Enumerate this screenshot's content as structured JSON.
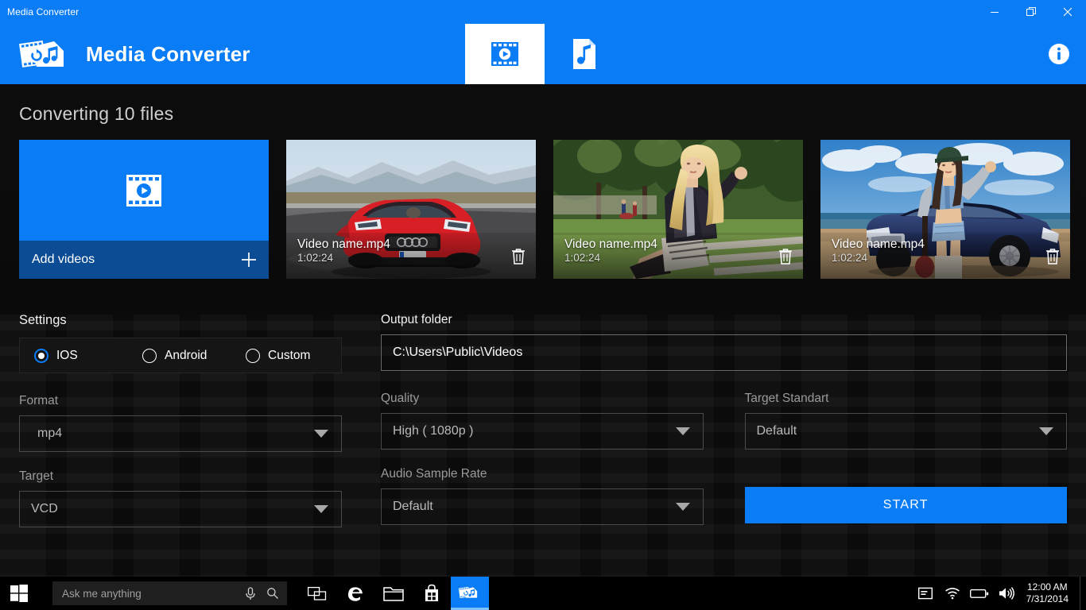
{
  "window": {
    "caption": "Media Converter",
    "minimize_label": "Minimize",
    "restore_label": "Restore",
    "close_label": "Close"
  },
  "header": {
    "brand_title": "Media Converter",
    "accent_color": "#0a7cf5",
    "tabs": [
      {
        "name": "video",
        "icon": "video-film-icon",
        "active": true
      },
      {
        "name": "audio",
        "icon": "audio-file-note-icon",
        "active": false
      }
    ],
    "info_label": "Info"
  },
  "main": {
    "page_title": "Converting 10 files",
    "add_tile": {
      "label": "Add videos",
      "icon": "video-film-play-icon",
      "plus_icon": "plus-icon"
    },
    "videos": [
      {
        "name": "Video name.mp4",
        "duration": "1:02:24",
        "delete_icon": "trash-icon",
        "thumb": "red-sports-car-on-mountain-road"
      },
      {
        "name": "Video name.mp4",
        "duration": "1:02:24",
        "delete_icon": "trash-icon",
        "thumb": "blonde-woman-on-park-bench"
      },
      {
        "name": "Video name.mp4",
        "duration": "1:02:24",
        "delete_icon": "trash-icon",
        "thumb": "woman-beside-blue-car-at-beach"
      }
    ],
    "settings": {
      "section_title": "Settings",
      "presets": [
        {
          "label": "IOS",
          "selected": true
        },
        {
          "label": "Android",
          "selected": false
        },
        {
          "label": "Custom",
          "selected": false
        }
      ],
      "format": {
        "label": "Format",
        "value": "mp4"
      },
      "target": {
        "label": "Target",
        "value": "VCD"
      }
    },
    "output": {
      "label": "Output folder",
      "value": "C:\\Users\\Public\\Videos"
    },
    "quality": {
      "label": "Quality",
      "value": "High ( 1080p )"
    },
    "audio_sample_rate": {
      "label": "Audio Sample Rate",
      "value": "Default"
    },
    "target_standart": {
      "label": "Target Standart",
      "value": "Default"
    },
    "start_button": {
      "label": "START",
      "color": "#0a7cf5"
    }
  },
  "taskbar": {
    "start_icon": "windows-start-icon",
    "search": {
      "placeholder": "Ask me anything",
      "mic_icon": "microphone-icon",
      "search_icon": "search-icon"
    },
    "items": [
      {
        "name": "task-view",
        "icon": "task-view-icon",
        "active": false
      },
      {
        "name": "edge",
        "icon": "edge-browser-icon",
        "active": false
      },
      {
        "name": "file-explorer",
        "icon": "folder-icon",
        "active": false
      },
      {
        "name": "store",
        "icon": "store-bag-icon",
        "active": false
      },
      {
        "name": "media-converter",
        "icon": "media-converter-icon",
        "active": true
      }
    ],
    "tray": [
      {
        "name": "action-center",
        "icon": "action-center-icon"
      },
      {
        "name": "network",
        "icon": "wifi-icon"
      },
      {
        "name": "battery",
        "icon": "battery-icon"
      },
      {
        "name": "volume",
        "icon": "speaker-icon"
      }
    ],
    "clock": {
      "time": "12:00 AM",
      "date": "7/31/2014"
    }
  }
}
